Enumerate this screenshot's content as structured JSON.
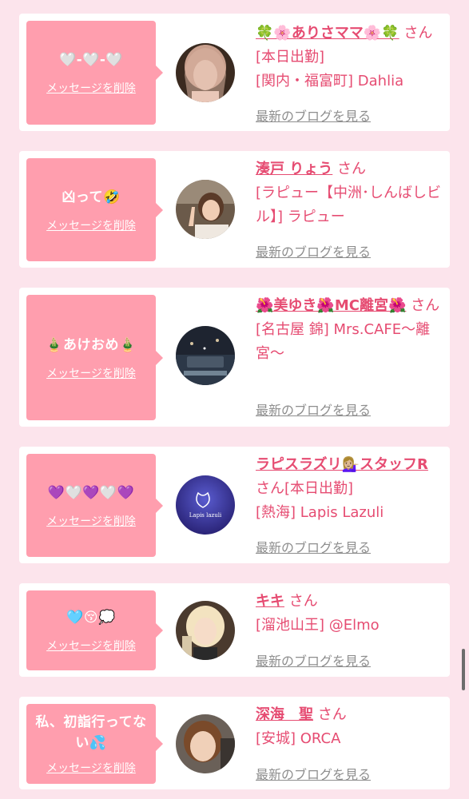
{
  "delete_label": "メッセージを削除",
  "blog_label": "最新のブログを見る",
  "san_suffix": "さん",
  "colors": {
    "background": "#fce4ec",
    "bubble": "#ff9eae",
    "accent": "#e64c72",
    "muted": "#8e8e8e"
  },
  "cards": [
    {
      "message": "🤍-🤍-🤍",
      "name": "🍀🌸ありさママ🌸🍀",
      "status": "さん[本日出勤]",
      "shop": "[関内・福富町] Dahlia",
      "avatar_icon": "woman-portrait"
    },
    {
      "message": "凶って🤣",
      "name": "湊戸 りょう",
      "status": "さん",
      "shop": "[ラピュー【中洲･しんばしビル】] ラピュー",
      "avatar_icon": "woman-peace-sign"
    },
    {
      "message": "🎍あけおめ🎍",
      "name": "🌺美ゆき🌺MC離宮🌺",
      "status": "さん",
      "shop": "[名古屋 錦] Mrs.CAFE〜離宮〜",
      "avatar_icon": "new-year-2024"
    },
    {
      "message": "💜🤍💜🤍💜",
      "name": "ラピスラズリ💁🏼‍♀️スタッフR",
      "status": "さん[本日出勤]",
      "shop": "[熱海] Lapis Lazuli",
      "avatar_icon": "lapis-lazuli-logo",
      "avatar_text": "Lapis lazuli"
    },
    {
      "message": "🩵😚💭",
      "name": "キキ",
      "status": "さん",
      "shop": "[溜池山王] @Elmo",
      "avatar_icon": "blonde-woman"
    },
    {
      "message": "私、初詣行ってない💦",
      "name": "深海　聖",
      "status": "さん",
      "shop": "[安城] ORCA",
      "avatar_icon": "woman-selfie"
    }
  ]
}
